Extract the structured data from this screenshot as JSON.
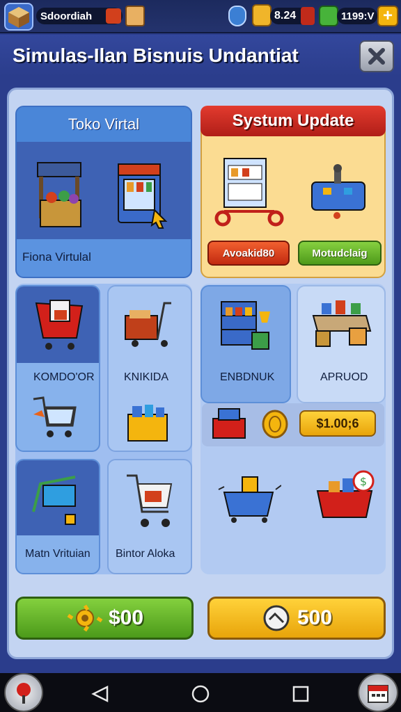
{
  "topbar": {
    "player_name": "Sdoordiah",
    "gems": "8.24",
    "cash": "1199:V"
  },
  "title": "Simulas-Ilan Bisnuis Undantiat",
  "cards": {
    "toko": {
      "header": "Toko Virtal",
      "label": "Fiona Virtulal"
    },
    "update": {
      "header": "Systum Update",
      "btn_left": "Avoakid80",
      "btn_right": "Motudclaig"
    },
    "komdor": {
      "label": "KOMDO'OR"
    },
    "knikida": {
      "label": "KNIKIDA"
    },
    "enbdnuk": {
      "label": "ENBDNUK"
    },
    "apruod": {
      "label": "APRUOD"
    },
    "price_tag": "$1.00;6",
    "matn": {
      "label": "Matn Vrituian"
    },
    "bintor": {
      "label": "Bintor Aloka"
    }
  },
  "actions": {
    "green_label": "$00",
    "yellow_label": "500"
  },
  "colors": {
    "green": "#5cb82a",
    "yellow": "#f4b50e",
    "red": "#d4261c",
    "panel": "#c3d4f2",
    "blue": "#4a86d8"
  },
  "icons": [
    "box-icon",
    "flag-icon",
    "shield-icon",
    "chest-icon",
    "cash-icon",
    "plus-icon",
    "close-icon",
    "shop-stall-icon",
    "vending-machine-icon",
    "cart-icon",
    "gear-icon",
    "back-icon",
    "home-icon",
    "recent-icon",
    "calendar-icon",
    "pin-icon"
  ]
}
